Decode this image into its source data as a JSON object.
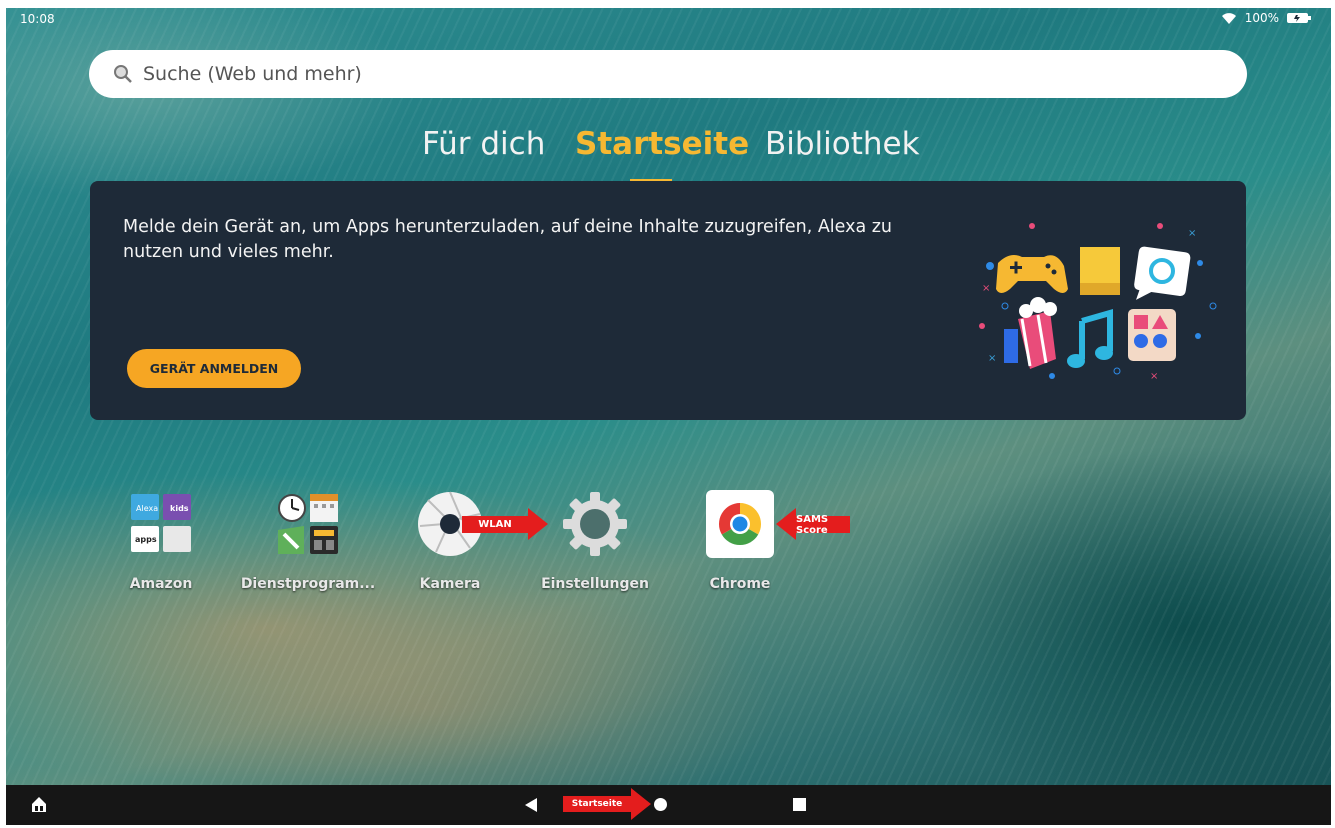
{
  "status": {
    "time": "10:08",
    "battery": "100%"
  },
  "search": {
    "placeholder": "Suche (Web und mehr)"
  },
  "tabs": [
    {
      "label": "Für dich",
      "active": false
    },
    {
      "label": "Startseite",
      "active": true
    },
    {
      "label": "Bibliothek",
      "active": false
    }
  ],
  "banner": {
    "text": "Melde dein Gerät an, um Apps herunterzuladen, auf deine Inhalte zuzugreifen, Alexa zu nutzen und vieles mehr.",
    "button_label": "GERÄT ANMELDEN"
  },
  "apps": [
    {
      "label": "Amazon",
      "icon": "amazon-folder-icon"
    },
    {
      "label": "Dienstprogram...",
      "icon": "utilities-folder-icon"
    },
    {
      "label": "Kamera",
      "icon": "camera-icon"
    },
    {
      "label": "Einstellungen",
      "icon": "settings-gear-icon"
    },
    {
      "label": "Chrome",
      "icon": "chrome-icon"
    }
  ],
  "annotations": {
    "wlan": "WLAN",
    "chrome": "SAMS Score",
    "home": "Startseite"
  },
  "folder_labels": {
    "amazon_top_left": "Alexa",
    "amazon_top_right": "kids",
    "amazon_bottom_left": "apps"
  },
  "colors": {
    "accent": "#f6b832",
    "banner_bg": "#1e2a38",
    "annotation": "#e41d1d"
  }
}
